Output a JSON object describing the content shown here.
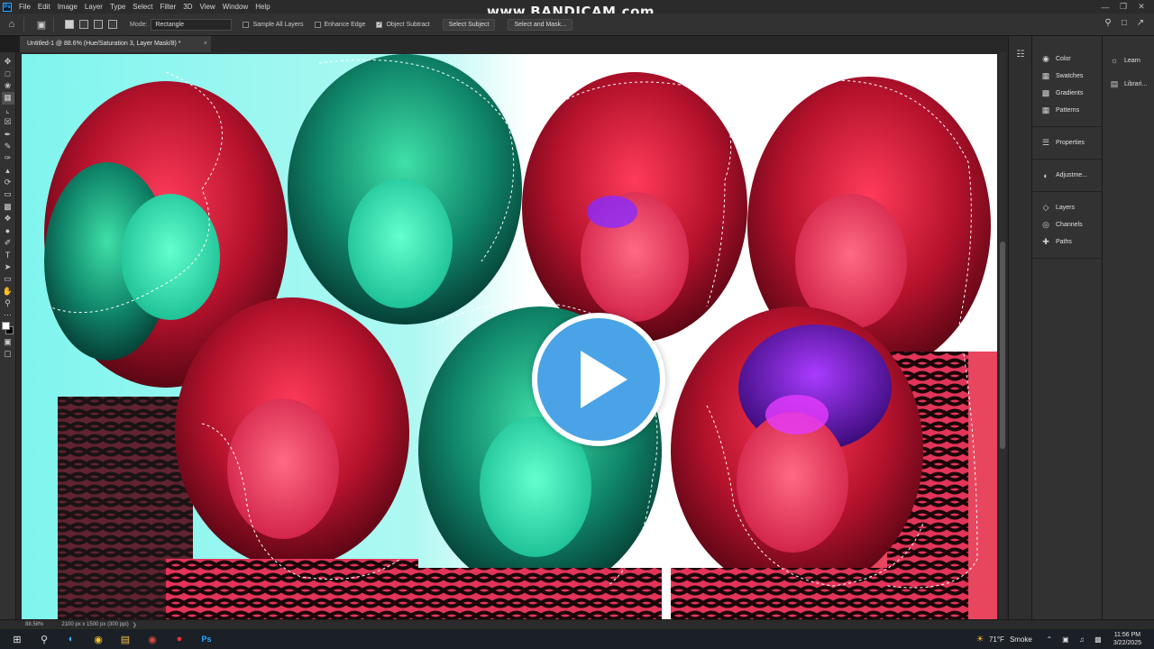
{
  "watermark": "www.BANDICAM.com",
  "menu": [
    "File",
    "Edit",
    "Image",
    "Layer",
    "Type",
    "Select",
    "Filter",
    "3D",
    "View",
    "Window",
    "Help"
  ],
  "app_logo": "Ps",
  "window_controls": [
    "minimize-icon",
    "restore-icon",
    "close-icon"
  ],
  "options": {
    "mode_label": "Mode:",
    "mode_value": "Rectangle",
    "sample_all_layers": {
      "label": "Sample All Layers",
      "checked": false
    },
    "enhance_edge": {
      "label": "Enhance Edge",
      "checked": false
    },
    "object_subtract": {
      "label": "Object Subtract",
      "checked": true
    },
    "select_subject_label": "Select Subject",
    "select_and_mask_label": "Select and Mask...",
    "right_icons": [
      "search-icon",
      "workspace-icon",
      "share-icon"
    ]
  },
  "document_tab": {
    "title": "Untitled-1 @ 88.6% (Hue/Saturation 3, Layer Mask/8) *",
    "close": "×"
  },
  "tools": [
    "move-tool-icon",
    "artboard-tool-icon",
    "lasso-tool-icon",
    "object-selection-tool-icon",
    "crop-tool-icon",
    "frame-tool-icon",
    "eyedropper-tool-icon",
    "healing-brush-icon",
    "brush-tool-icon",
    "clone-stamp-icon",
    "history-brush-icon",
    "eraser-tool-icon",
    "gradient-tool-icon",
    "blur-tool-icon",
    "dodge-tool-icon",
    "pen-tool-icon",
    "type-tool-icon",
    "path-selection-icon",
    "rectangle-tool-icon",
    "hand-tool-icon",
    "zoom-tool-icon",
    "more-tools-icon"
  ],
  "colors": {
    "foreground": "#ffffff",
    "background": "#000000",
    "accent": "#31a8ff",
    "play_button": "#4aa3e6"
  },
  "panels_primary": [
    {
      "label": "Color",
      "icon": "color-panel-icon"
    },
    {
      "label": "Swatches",
      "icon": "swatches-panel-icon"
    },
    {
      "label": "Gradients",
      "icon": "gradients-panel-icon"
    },
    {
      "label": "Patterns",
      "icon": "patterns-panel-icon"
    },
    {
      "label": "Properties",
      "icon": "properties-panel-icon"
    },
    {
      "label": "Adjustme...",
      "icon": "adjustments-panel-icon"
    },
    {
      "label": "Layers",
      "icon": "layers-panel-icon"
    },
    {
      "label": "Channels",
      "icon": "channels-panel-icon"
    },
    {
      "label": "Paths",
      "icon": "paths-panel-icon"
    }
  ],
  "panels_secondary": [
    {
      "label": "Learn",
      "icon": "learn-panel-icon"
    },
    {
      "label": "Librari...",
      "icon": "libraries-panel-icon"
    }
  ],
  "status": {
    "zoom": "88.58%",
    "dimensions": "2100 px x 1500 px (300 ppi)"
  },
  "taskbar": {
    "icons": [
      "windows-start-icon",
      "search-taskbar-icon",
      "edge-browser-icon",
      "chrome-browser-icon",
      "file-explorer-icon",
      "chrome-alt-icon",
      "record-icon",
      "photoshop-taskbar-icon"
    ],
    "weather_temp": "71°F",
    "weather_condition": "Smoke",
    "time": "11:56 PM",
    "date": "3/22/2025"
  }
}
